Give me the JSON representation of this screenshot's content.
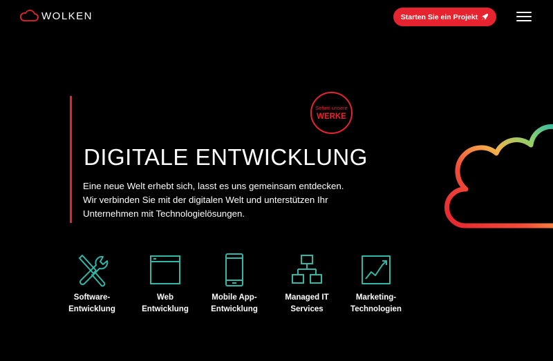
{
  "header": {
    "logo_text": "WOLKEN",
    "cta_label": "Starten Sie ein Projekt",
    "menu_icon": "hamburger-menu-icon"
  },
  "badge": {
    "line1": "Sehen unsere",
    "line2": "WERKE"
  },
  "hero": {
    "title": "DIGITALE ENTWICKLUNG",
    "description_lines": [
      "Eine neue Welt erhebt sich, lasst es uns gemeinsam entdecken.",
      "Wir verbinden Sie mit der digitalen Welt und unterstützen Ihr",
      "Unternehmen mit Technologielösungen."
    ]
  },
  "services": [
    {
      "icon": "tools-icon",
      "label_lines": [
        "Software-",
        "Entwicklung"
      ]
    },
    {
      "icon": "browser-window-icon",
      "label_lines": [
        "Web",
        "Entwicklung"
      ]
    },
    {
      "icon": "smartphone-icon",
      "label_lines": [
        "Mobile App-",
        "Entwicklung"
      ]
    },
    {
      "icon": "network-hierarchy-icon",
      "label_lines": [
        "Managed IT",
        "Services"
      ]
    },
    {
      "icon": "line-chart-icon",
      "label_lines": [
        "Marketing-",
        "Technologien"
      ]
    }
  ],
  "colors": {
    "accent_red": "#e6242f",
    "icon_teal": "#2fb8a8",
    "background": "#000000"
  }
}
